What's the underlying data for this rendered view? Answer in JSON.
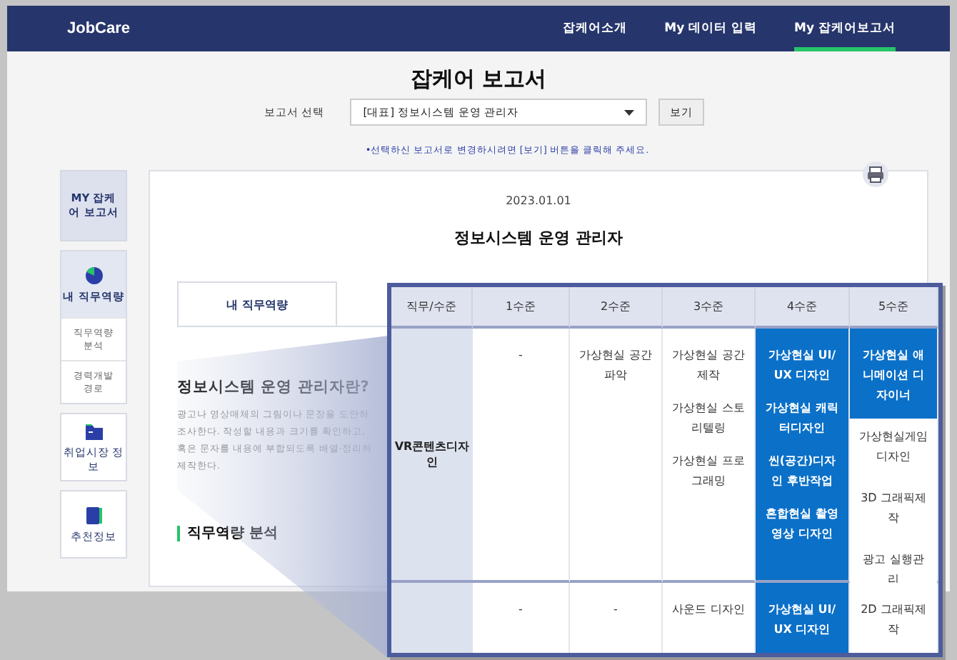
{
  "header": {
    "logo": "JobCare",
    "nav": [
      {
        "label": "잡케어소개",
        "selected": false
      },
      {
        "label": "My 데이터 입력",
        "selected": false
      },
      {
        "label": "My 잡케어보고서",
        "selected": true
      }
    ]
  },
  "page_title": "잡케어 보고서",
  "report_select": {
    "label": "보고서 선택",
    "value": "[대표] 정보시스템 운영 관리자",
    "button": "보기",
    "note": "•선택하신 보고서로 변경하시려면 [보기] 버튼을 클릭해 주세요."
  },
  "sidebar": {
    "title": "MY 잡케어 보고서",
    "items": [
      {
        "label": "내 직무역량",
        "selected": true,
        "children": [
          {
            "label": "직무역량 분석"
          },
          {
            "label": "경력개발 경로"
          }
        ]
      },
      {
        "label": "취업시장 정보",
        "selected": false
      },
      {
        "label": "추천정보",
        "selected": false
      }
    ]
  },
  "report": {
    "date": "2023.01.01",
    "title": "정보시스템 운영 관리자",
    "tab": "내 직무역량",
    "heading": "정보시스템 운영 관리자란?",
    "description": [
      "광고나 영상매체의 그림이나 문장을 도안하",
      "조사한다. 작성할 내용과 크기를 확인하고,",
      "혹은 문자를 내용에 부합되도록 배열·정리하",
      "제작한다."
    ],
    "section_heading": "직무역량 분석"
  },
  "zoom_table": {
    "columns": [
      "직무/수준",
      "1수준",
      "2수준",
      "3수준",
      "4수준",
      "5수준"
    ],
    "rows": [
      {
        "cells": [
          {
            "items": [
              {
                "text": "VR콘텐츠디자인",
                "highlighted": false
              }
            ]
          },
          {
            "items": [
              {
                "text": "-",
                "highlighted": false
              }
            ]
          },
          {
            "items": [
              {
                "text": "가상현실 공간파악",
                "highlighted": false
              }
            ]
          },
          {
            "items": [
              {
                "text": "가상현실 공간제작",
                "highlighted": false
              },
              {
                "text": "가상현실 스토리텔링",
                "highlighted": false
              },
              {
                "text": "가상현실 프로그래밍",
                "highlighted": false
              }
            ]
          },
          {
            "items": [
              {
                "text": "가상현실 UI/UX 디자인",
                "highlighted": true
              },
              {
                "text": "가상현실 캐릭터디자인",
                "highlighted": true
              },
              {
                "text": "씬(공간)디자인 후반작업",
                "highlighted": true
              },
              {
                "text": "혼합현실 촬영영상 디자인",
                "highlighted": true
              }
            ]
          },
          {
            "items": [
              {
                "text": "가상현실 애니메이션 디자이너",
                "highlighted": true
              },
              {
                "text": "가상현실게임 디자인",
                "highlighted": false
              },
              {
                "text": "3D 그래픽제작",
                "highlighted": false
              },
              {
                "text": "광고 실행관리",
                "highlighted": false
              }
            ]
          }
        ]
      },
      {
        "cells": [
          {},
          {
            "items": [
              {
                "text": "-",
                "highlighted": false
              }
            ]
          },
          {
            "items": [
              {
                "text": "-",
                "highlighted": false
              }
            ]
          },
          {
            "items": [
              {
                "text": "사운드 디자인",
                "highlighted": false
              }
            ]
          },
          {
            "items": [
              {
                "text": "가상현실 UI/UX 디자인",
                "highlighted": true
              }
            ]
          },
          {
            "items": [
              {
                "text": "2D 그래픽제작",
                "highlighted": false
              }
            ]
          }
        ]
      }
    ]
  }
}
